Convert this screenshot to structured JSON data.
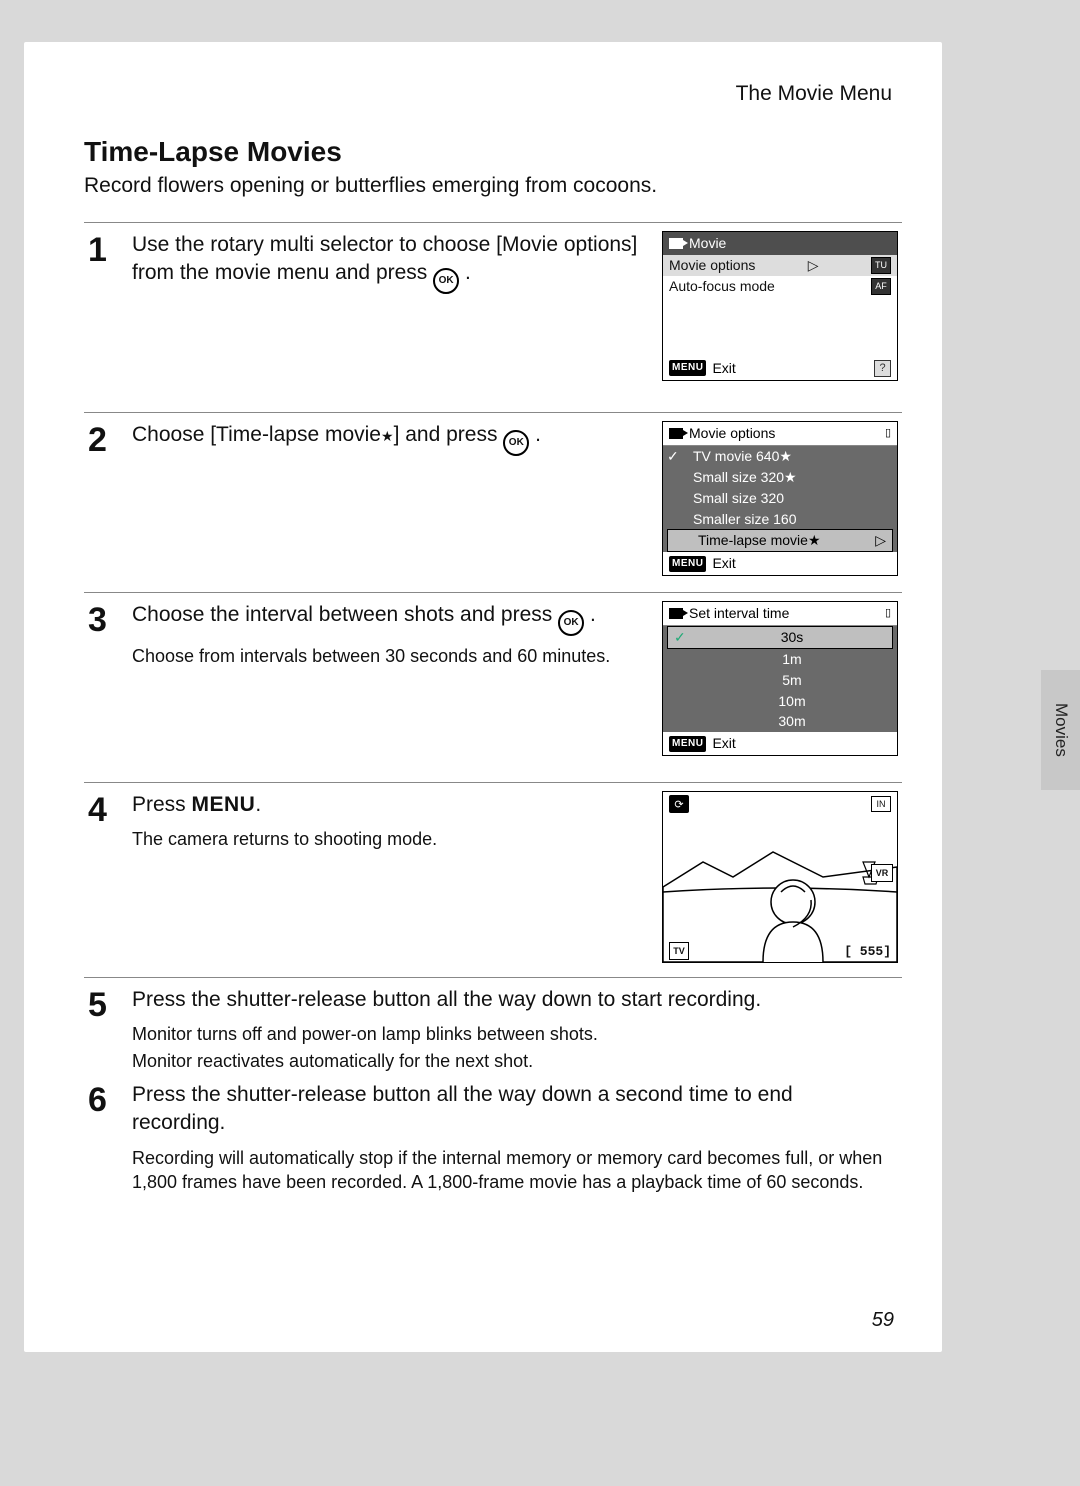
{
  "header": {
    "title": "The Movie Menu"
  },
  "section": {
    "title": "Time-Lapse Movies",
    "subtitle": "Record flowers opening or butterflies emerging from cocoons."
  },
  "steps": {
    "s1": {
      "num": "1",
      "text_a": "Use the rotary multi selector to choose [Movie options] from the movie menu and press ",
      "text_b": "."
    },
    "s2": {
      "num": "2",
      "text_a": "Choose [Time-lapse movie",
      "text_b": "] and press ",
      "text_c": "."
    },
    "s3": {
      "num": "3",
      "text_a": "Choose the interval between shots and press ",
      "text_b": ".",
      "hint": "Choose from intervals between 30 seconds and 60 minutes."
    },
    "s4": {
      "num": "4",
      "text_a": "Press ",
      "menu": "MENU",
      "text_b": ".",
      "hint": "The camera returns to shooting mode."
    },
    "s5": {
      "num": "5",
      "text": "Press the shutter-release button all the way down to start recording.",
      "hint1": "Monitor turns off and power-on lamp blinks between shots.",
      "hint2": "Monitor reactivates automatically for the next shot."
    },
    "s6": {
      "num": "6",
      "text": "Press the shutter-release button all the way down a second time to end recording.",
      "hint": "Recording will automatically stop if the internal memory or memory card becomes full, or when 1,800 frames have been recorded. A 1,800-frame movie has a playback time of 60 seconds."
    }
  },
  "lcd1": {
    "title": "Movie",
    "item_selected": "Movie options",
    "item2": "Auto-focus mode",
    "foot": "Exit",
    "menu_label": "MENU",
    "help": "?",
    "icon1": "TU",
    "icon2": "AF"
  },
  "lcd2": {
    "title": "Movie options",
    "items": {
      "i1": "TV movie 640",
      "i2": "Small size 320",
      "i3": "Small size 320",
      "i4": "Smaller size 160",
      "i5": "Time-lapse movie"
    },
    "foot": "Exit",
    "menu_label": "MENU"
  },
  "lcd3": {
    "title": "Set interval time",
    "items": {
      "i1": "30s",
      "i2": "1m",
      "i3": "5m",
      "i4": "10m",
      "i5": "30m"
    },
    "foot": "Exit",
    "menu_label": "MENU"
  },
  "lcd4": {
    "tv": "TV",
    "mem": "IN",
    "vr": "VR",
    "count": "[  555]"
  },
  "ok_label": "OK",
  "side_tab": "Movies",
  "page_number": "59"
}
